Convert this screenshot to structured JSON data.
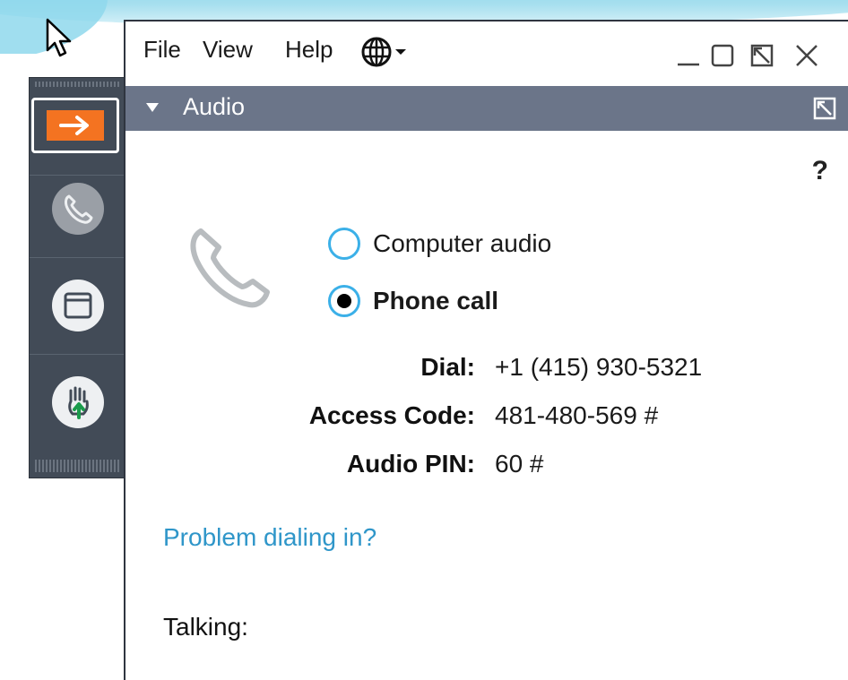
{
  "menu": {
    "file": "File",
    "view": "View",
    "help": "Help"
  },
  "icons": {
    "globe": "globe-icon",
    "minimize": "minimize-icon",
    "restore": "restore-icon",
    "popout": "popout-icon",
    "close": "close-icon"
  },
  "audio_panel": {
    "title": "Audio",
    "help": "?",
    "options": [
      {
        "label": "Computer audio",
        "selected": false
      },
      {
        "label": "Phone call",
        "selected": true
      }
    ],
    "dial_label": "Dial:",
    "dial_value": "+1 (415) 930-5321",
    "access_label": "Access Code:",
    "access_value": "481-480-569 #",
    "pin_label": "Audio PIN:",
    "pin_value": "60 #",
    "problem_link": "Problem dialing in?",
    "talking_label": "Talking:"
  },
  "colors": {
    "panel_header": "#6b7589",
    "control_panel": "#424b57",
    "accent_orange": "#f47321",
    "radio_blue": "#3bb0e8",
    "link_blue": "#2f96c9"
  }
}
